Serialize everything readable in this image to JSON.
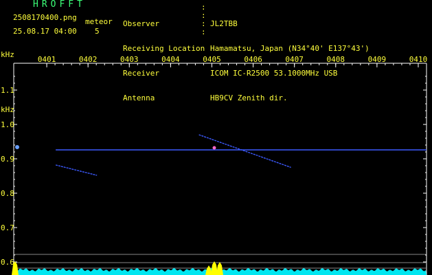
{
  "header": {
    "app_title": "HROFFT",
    "file_name": "2508170400.png",
    "date_time": "25.08.17 04:00",
    "meteor_label": "meteor",
    "meteor_count": "5"
  },
  "info": [
    {
      "label": "Observer",
      "value": "JL2TBB"
    },
    {
      "label": "Receiving Location",
      "value": "Hamamatsu, Japan (N34°40' E137°43')"
    },
    {
      "label": "Receiver",
      "value": "ICOM IC-R2500 53.1000MHz USB"
    },
    {
      "label": "Antenna",
      "value": "HB9CV Zenith dir."
    }
  ],
  "colors": {
    "text_yellow": "#ffff3c",
    "title_green": "#3cff78",
    "axis_white": "#ffffff",
    "signal_blue": "#3c5aff",
    "spectrum_cyan": "#00e6f0",
    "peak_yellow": "#ffff00"
  },
  "chart_data": {
    "type": "spectrogram",
    "ylabel": "kHz",
    "x_ticks": [
      "0401",
      "0402",
      "0403",
      "0404",
      "0405",
      "0406",
      "0407",
      "0408",
      "0409",
      "0410"
    ],
    "y_ticks": [
      "1.1",
      "1.0",
      "0.9",
      "0.8",
      "0.7",
      "0.6"
    ],
    "xlim_minutes": [
      0,
      10
    ],
    "ylim_khz": [
      0.58,
      1.16
    ],
    "carrier": {
      "freq_khz": 0.926,
      "start_min": 0.85,
      "end_min": 10.0
    },
    "traces": [
      {
        "start_min": 4.32,
        "start_khz": 0.97,
        "end_min": 6.55,
        "end_khz": 0.875
      },
      {
        "start_min": 0.85,
        "start_khz": 0.882,
        "end_min": 1.85,
        "end_khz": 0.852
      }
    ],
    "spectrum_peaks_min": [
      0.0,
      4.6,
      4.9,
      5.1
    ]
  }
}
